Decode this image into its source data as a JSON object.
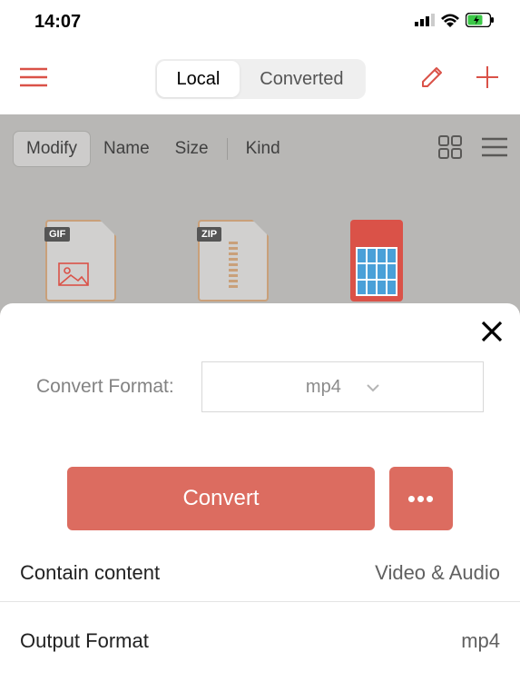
{
  "status": {
    "time": "14:07"
  },
  "nav": {
    "tabs": [
      "Local",
      "Converted"
    ],
    "active": 0
  },
  "toolbar": {
    "items": [
      "Modify",
      "Name",
      "Size",
      "Kind"
    ],
    "active": 0
  },
  "files": [
    {
      "badge": "GIF"
    },
    {
      "badge": "ZIP"
    },
    {
      "poster": true
    }
  ],
  "sheet": {
    "format_label": "Convert Format:",
    "format_value": "mp4",
    "convert_label": "Convert",
    "rows": [
      {
        "label": "Contain content",
        "value": "Video & Audio"
      },
      {
        "label": "Output Format",
        "value": "mp4"
      }
    ]
  }
}
